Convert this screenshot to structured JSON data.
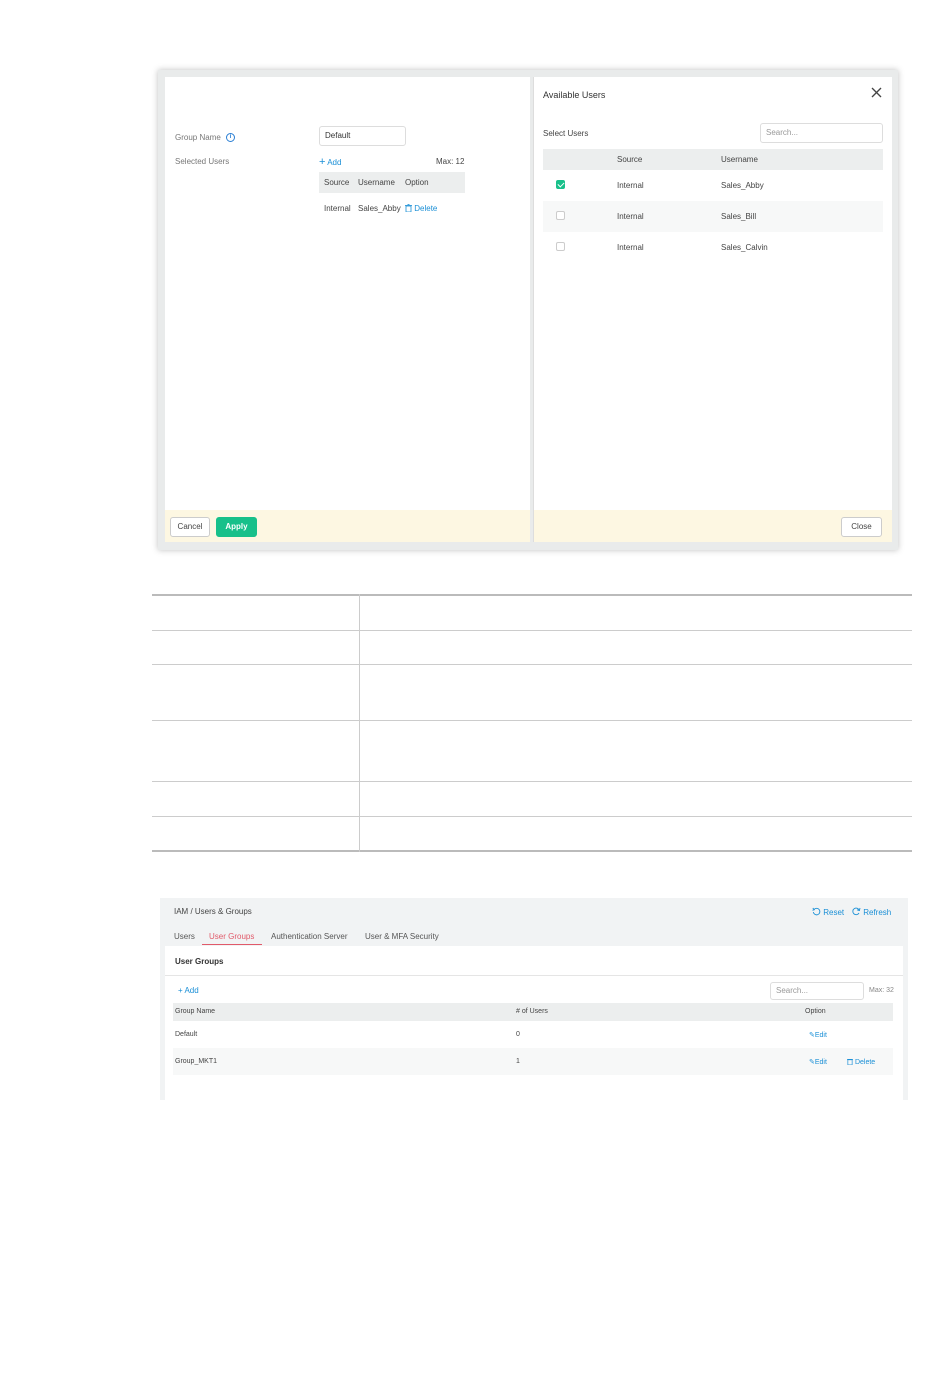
{
  "dialog": {
    "group_name_label": "Group Name",
    "group_name_value": "Default",
    "selected_users_label": "Selected Users",
    "add_label": "Add",
    "max_label": "Max: 12",
    "selected_headers": [
      "Source",
      "Username",
      "Option"
    ],
    "selected_rows": [
      {
        "source": "Internal",
        "username": "Sales_Abby",
        "option": "Delete"
      }
    ],
    "cancel_label": "Cancel",
    "apply_label": "Apply",
    "available": {
      "title": "Available Users",
      "select_users_label": "Select Users",
      "search_placeholder": "Search...",
      "headers": [
        "Source",
        "Username"
      ],
      "rows": [
        {
          "checked": true,
          "source": "Internal",
          "username": "Sales_Abby"
        },
        {
          "checked": false,
          "source": "Internal",
          "username": "Sales_Bill"
        },
        {
          "checked": false,
          "source": "Internal",
          "username": "Sales_Calvin"
        }
      ],
      "close_label": "Close"
    }
  },
  "user_groups_page": {
    "breadcrumb": "IAM / Users & Groups",
    "reset_label": "Reset",
    "refresh_label": "Refresh",
    "tabs": [
      "Users",
      "User Groups",
      "Authentication Server",
      "User & MFA Security"
    ],
    "active_tab": 1,
    "section_title": "User Groups",
    "add_label": "+ Add",
    "search_placeholder": "Search...",
    "max_label": "Max: 32",
    "headers": [
      "Group Name",
      "# of Users",
      "Option"
    ],
    "rows": [
      {
        "name": "Default",
        "users": "0",
        "edit": "Edit",
        "delete": ""
      },
      {
        "name": "Group_MKT1",
        "users": "1",
        "edit": "Edit",
        "delete": "Delete"
      }
    ]
  },
  "colors": {
    "accent_green": "#18c08a",
    "link_blue": "#1a8fd6",
    "active_tab": "#e15a6a",
    "footer_bar": "#fdf7e2"
  }
}
